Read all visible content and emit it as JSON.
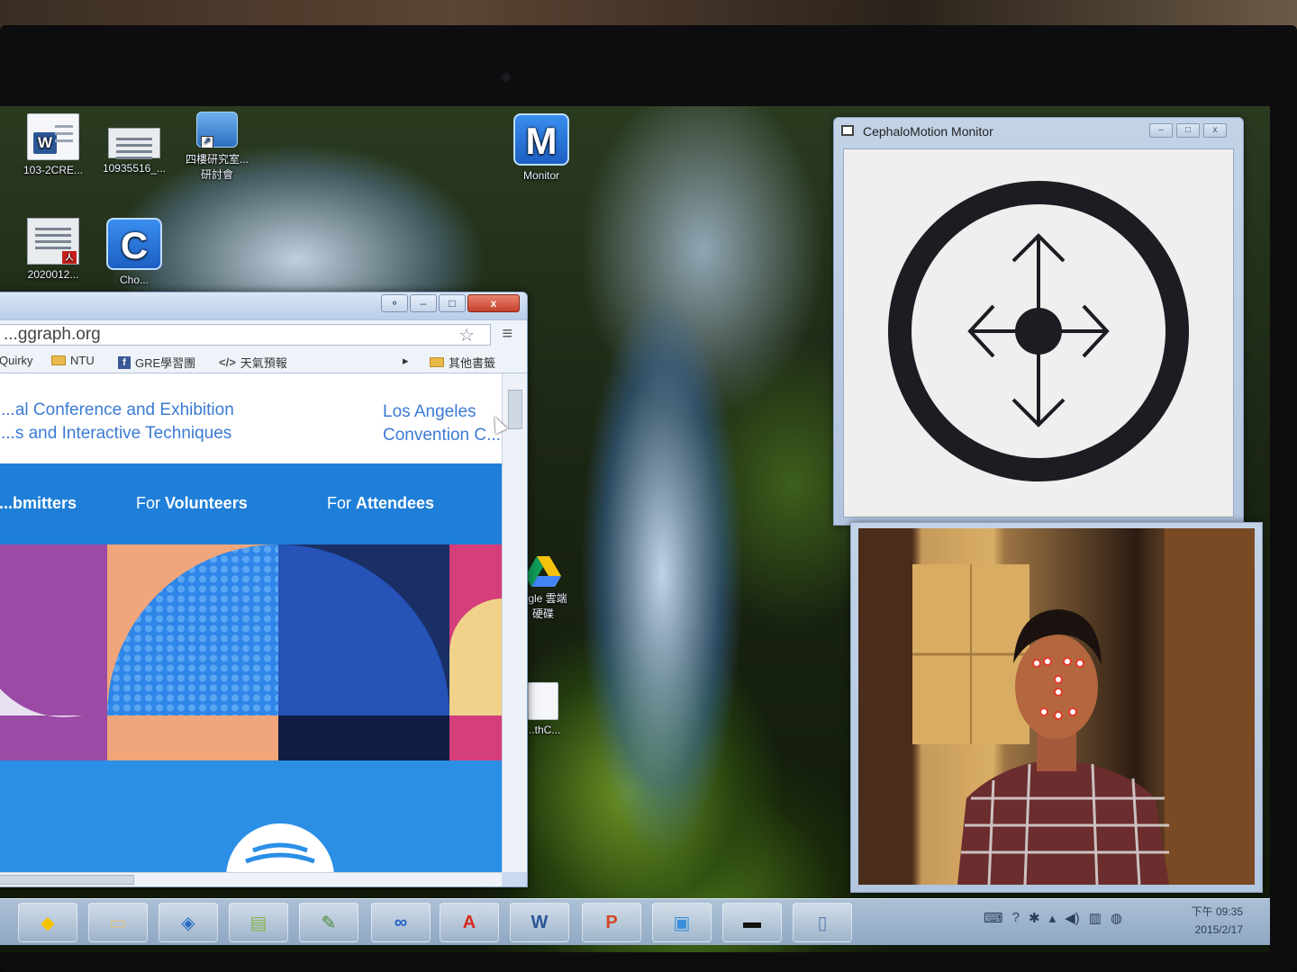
{
  "desktop": {
    "icons": [
      {
        "label": "103-2CRE..."
      },
      {
        "label": "10935516_..."
      },
      {
        "label": "四樓研究室...\n研討會"
      },
      {
        "label": "Monitor",
        "letter": "M"
      },
      {
        "label": "2020012..."
      },
      {
        "label": "Cho...",
        "letter": "C"
      },
      {
        "label": "...gle 雲端\n硬碟"
      },
      {
        "label": "...thC..."
      }
    ]
  },
  "browser": {
    "address": "...ggraph.org",
    "bookmarks": [
      "Quirky",
      "NTU",
      "GRE學習團",
      "天氣預報",
      "其他書籤"
    ],
    "header_left": [
      "...al Conference and Exhibition",
      "...s and Interactive Techniques"
    ],
    "header_right": [
      "Los Angeles",
      "Convention C..."
    ],
    "nav": [
      {
        "label": "...bmitters"
      },
      {
        "label_pre": "For ",
        "label_bold": "Volunteers"
      },
      {
        "label_pre": "For ",
        "label_bold": "Attendees"
      }
    ],
    "controls": {
      "minimize": "–",
      "maximize": "□",
      "close": "x"
    }
  },
  "cephalo": {
    "title": "CephaloMotion Monitor",
    "controls": {
      "minimize": "–",
      "maximize": "□",
      "close": "x"
    },
    "indicator_icon": "move-arrows-icon"
  },
  "webcam": {
    "tracking_points": 9
  },
  "taskbar": {
    "apps": [
      "rss-icon",
      "file-explorer-icon",
      "network-icon",
      "photos-icon",
      "notepad-icon",
      "infinity-icon",
      "acrobat-icon",
      "word-icon",
      "powerpoint-icon",
      "remote-desktop-icon",
      "terminal-icon",
      "window-icon"
    ],
    "clock_time": "下午 09:35",
    "clock_date": "2015/2/17"
  },
  "colors": {
    "browser_blue": "#1f7fd8",
    "link_blue": "#3b7bd4",
    "close_red": "#c5412b"
  }
}
